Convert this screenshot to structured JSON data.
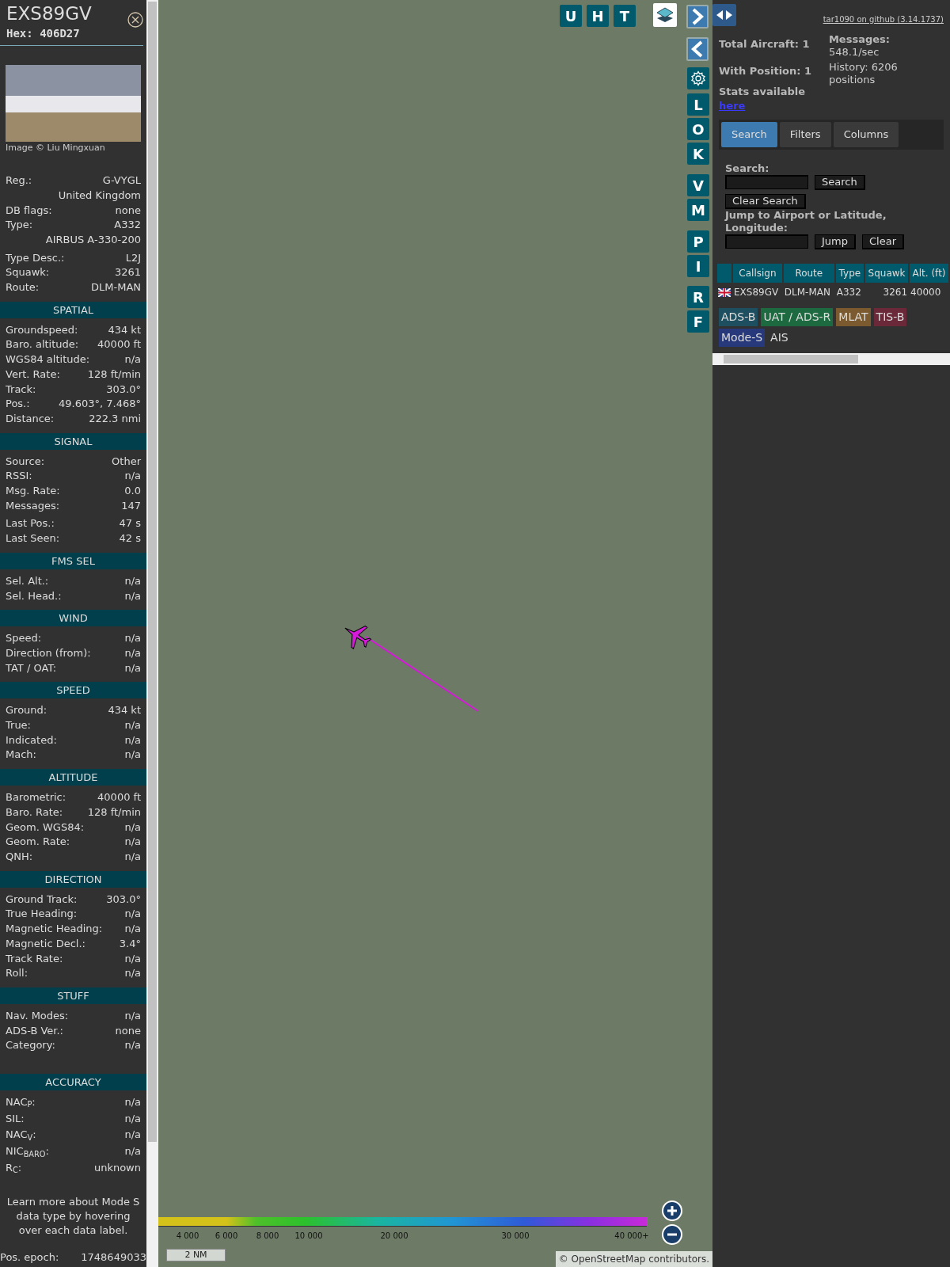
{
  "details": {
    "callsign": "EXS89GV",
    "hex": "Hex: 406D27",
    "photo_credit": "Image © Liu Mingxuan",
    "rows": [
      {
        "kind": "link",
        "label": "Reg.:",
        "value": "G-VYGL"
      },
      {
        "kind": "continuation",
        "value": "United Kingdom"
      },
      {
        "kind": "field",
        "label": "DB flags:",
        "value": "none"
      },
      {
        "kind": "field",
        "label": "Type:",
        "value": "A332"
      },
      {
        "kind": "continuation",
        "value": "AIRBUS A-330-200"
      },
      {
        "kind": "field",
        "label": "Type Desc.:",
        "value": "L2J"
      },
      {
        "kind": "field",
        "label": "Squawk:",
        "value": "3261"
      },
      {
        "kind": "field",
        "label": "Route:",
        "value": "DLM-MAN"
      }
    ],
    "sections": [
      {
        "title": "SPATIAL",
        "rows": [
          {
            "label": "Groundspeed:",
            "value": "434 kt"
          },
          {
            "label": "Baro. altitude:",
            "value": "40000 ft"
          },
          {
            "label": "WGS84 altitude:",
            "value": "n/a"
          },
          {
            "label": "Vert. Rate:",
            "value": "128 ft/min"
          },
          {
            "label": "Track:",
            "value": "303.0°"
          },
          {
            "label": "Pos.:",
            "value": "49.603°, 7.468°"
          },
          {
            "label": "Distance:",
            "value": "222.3 nmi"
          }
        ]
      },
      {
        "title": "SIGNAL",
        "rows": [
          {
            "label": "Source:",
            "value": "Other"
          },
          {
            "label": "RSSI:",
            "value": "n/a"
          },
          {
            "label": "Msg. Rate:",
            "value": "0.0"
          },
          {
            "label": "Messages:",
            "value": "147"
          },
          {
            "label": "Last Pos.:",
            "value": "47 s"
          },
          {
            "label": "Last Seen:",
            "value": "42 s"
          }
        ]
      },
      {
        "title": "FMS SEL",
        "rows": [
          {
            "label": "Sel. Alt.:",
            "value": "n/a"
          },
          {
            "label": "Sel. Head.:",
            "value": "n/a"
          }
        ]
      },
      {
        "title": "WIND",
        "rows": [
          {
            "label": "Speed:",
            "value": "n/a"
          },
          {
            "label": "Direction (from):",
            "value": "n/a"
          },
          {
            "label": "TAT / OAT:",
            "value": "n/a"
          }
        ]
      },
      {
        "title": "SPEED",
        "rows": [
          {
            "label": "Ground:",
            "value": "434 kt"
          },
          {
            "label": "True:",
            "value": "n/a"
          },
          {
            "label": "Indicated:",
            "value": "n/a"
          },
          {
            "label": "Mach:",
            "value": "n/a"
          }
        ]
      },
      {
        "title": "ALTITUDE",
        "rows": [
          {
            "label": "Barometric:",
            "value": "40000 ft"
          },
          {
            "label": "Baro. Rate:",
            "value": "128 ft/min"
          },
          {
            "label": "Geom. WGS84:",
            "value": "n/a"
          },
          {
            "label": "Geom. Rate:",
            "value": "n/a"
          },
          {
            "label": "QNH:",
            "value": "n/a"
          }
        ]
      },
      {
        "title": "DIRECTION",
        "rows": [
          {
            "label": "Ground Track:",
            "value": "303.0°"
          },
          {
            "label": "True Heading:",
            "value": "n/a"
          },
          {
            "label": "Magnetic Heading:",
            "value": "n/a"
          },
          {
            "label": "Magnetic Decl.:",
            "value": "3.4°"
          },
          {
            "label": "Track Rate:",
            "value": "n/a"
          },
          {
            "label": "Roll:",
            "value": "n/a"
          }
        ]
      },
      {
        "title": "STUFF",
        "rows": [
          {
            "label": "Nav. Modes:",
            "value": "n/a"
          },
          {
            "label": "ADS-B Ver.:",
            "value": "none"
          },
          {
            "label": "Category:",
            "value": "n/a"
          }
        ]
      },
      {
        "title": "ACCURACY",
        "rows": [
          {
            "label": "NAC$_{P}$:",
            "value": "n/a"
          },
          {
            "label": "SIL:",
            "value": "n/a"
          },
          {
            "label": "NAC$_{V}$:",
            "value": "n/a"
          },
          {
            "label": "NIC$_{BARO}$:",
            "value": "n/a"
          },
          {
            "label": "R$_{C}$:",
            "value": "unknown"
          }
        ]
      }
    ],
    "note": "Learn more about Mode S data type by hovering over each data label.",
    "epoch": {
      "label": "Pos. epoch:",
      "value": "1748649033"
    }
  },
  "map": {
    "top_buttons": [
      "U",
      "H",
      "T"
    ],
    "side_buttons": [
      "L",
      "O",
      "K",
      "V",
      "M",
      "P",
      "I",
      "R",
      "F"
    ],
    "altitude_legend": [
      "4 000",
      "6 000",
      "8 000",
      "10 000",
      "20 000",
      "30 000",
      "40 000+"
    ],
    "scale": "2 NM",
    "attribution_prefix": "©",
    "attribution_link": "OpenStreetMap",
    "attribution_suffix": "contributors."
  },
  "panel": {
    "version_link": "tar1090 on github (3.14.1737)",
    "stats": {
      "total": "Total Aircraft: 1",
      "with_position": "With Position: 1",
      "messages_label": "Messages:",
      "messages_value": "548.1/sec",
      "history": "History: 6206 positions",
      "stats_text": "Stats available",
      "stats_link": "here"
    },
    "tabs": [
      {
        "label": "Search",
        "selected": true
      },
      {
        "label": "Filters",
        "selected": false
      },
      {
        "label": "Columns",
        "selected": false
      }
    ],
    "search_label": "Search:",
    "search_button": "Search",
    "clear_search_button": "Clear Search",
    "jump_label": "Jump to Airport or Latitude, Longitude:",
    "jump_button": "Jump",
    "clear_button": "Clear",
    "table": {
      "columns": [
        "Callsign",
        "Route",
        "Type",
        "Squawk",
        "Alt. (ft)"
      ],
      "rows": [
        {
          "callsign": "EXS89GV",
          "route": "DLM-MAN",
          "type": "A332",
          "squawk": "3261",
          "altitude": "40000"
        }
      ]
    },
    "sources": [
      {
        "label": "ADS-B",
        "color": "#1d4f61"
      },
      {
        "label": "UAT / ADS-R",
        "color": "#1e6a40"
      },
      {
        "label": "MLAT",
        "color": "#7a5a2e"
      },
      {
        "label": "TIS-B",
        "color": "#6a2838"
      },
      {
        "label": "Mode-S",
        "color": "#27397a"
      },
      {
        "label": "AIS",
        "color": "#313131"
      }
    ]
  }
}
